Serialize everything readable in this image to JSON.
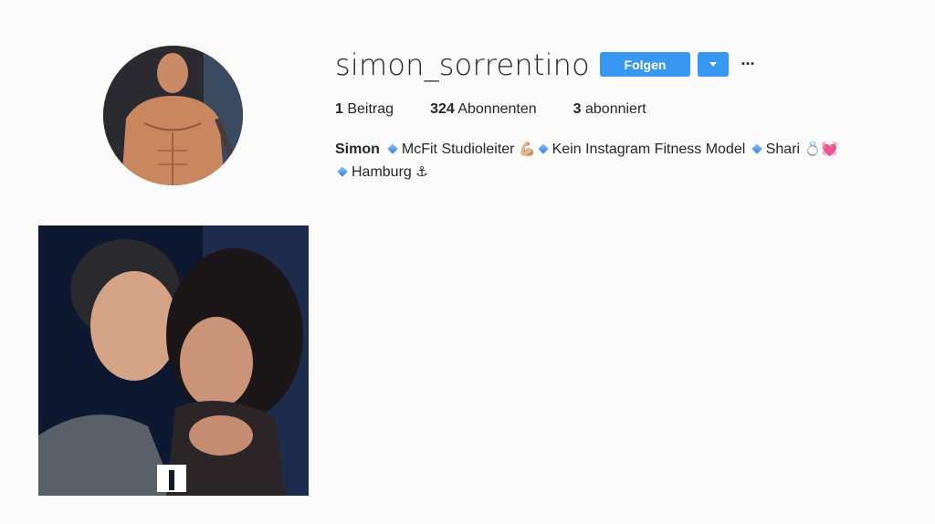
{
  "profile": {
    "username": "simon_sorrentino",
    "follow_label": "Folgen",
    "more_label": "···"
  },
  "stats": {
    "posts_count": "1",
    "posts_label": "Beitrag",
    "followers_count": "324",
    "followers_label": "Abonnenten",
    "following_count": "3",
    "following_label": "abonniert"
  },
  "bio": {
    "name": "Simon",
    "line1_a": "McFit Studioleiter",
    "line1_a_emoji": "💪🏼",
    "line1_b": "Kein Instagram Fitness Model",
    "line1_c": "Shari",
    "line1_c_emoji": "💍💓",
    "line2": "Hamburg",
    "line2_emoji": "⚓"
  },
  "icons": {
    "bullet": "small-blue-diamond-icon",
    "dropdown": "caret-down-icon",
    "more": "ellipsis-icon"
  },
  "colors": {
    "accent": "#3897f0",
    "background": "#fafafa",
    "text": "#262626"
  }
}
